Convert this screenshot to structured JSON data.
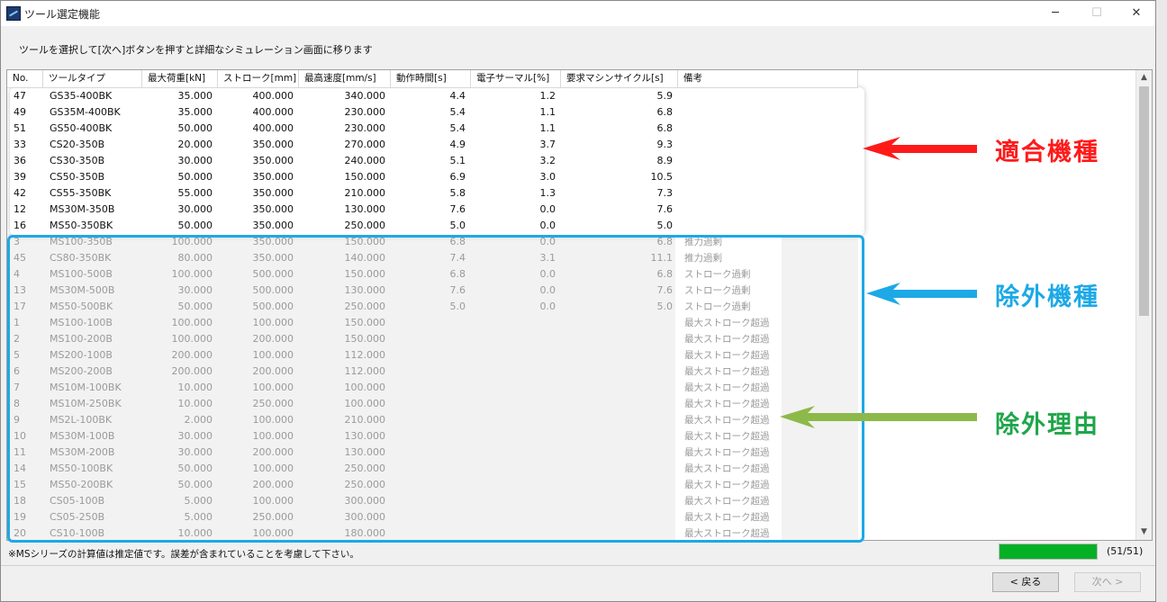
{
  "window": {
    "title": "ツール選定機能",
    "minimize": "─",
    "maximize": "☐",
    "close": "✕"
  },
  "instruction": "ツールを選択して[次へ]ボタンを押すと詳細なシミュレーション画面に移ります",
  "table": {
    "headers": [
      "No.",
      "ツールタイプ",
      "最大荷重[kN]",
      "ストローク[mm]",
      "最高速度[mm/s]",
      "動作時間[s]",
      "電子サーマル[%]",
      "要求マシンサイクル[s]",
      "備考"
    ],
    "ok_rows": [
      [
        "47",
        "GS35-400BK",
        "35.000",
        "400.000",
        "340.000",
        "4.4",
        "1.2",
        "5.9",
        ""
      ],
      [
        "49",
        "GS35M-400BK",
        "35.000",
        "400.000",
        "230.000",
        "5.4",
        "1.1",
        "6.8",
        ""
      ],
      [
        "51",
        "GS50-400BK",
        "50.000",
        "400.000",
        "230.000",
        "5.4",
        "1.1",
        "6.8",
        ""
      ],
      [
        "33",
        "CS20-350B",
        "20.000",
        "350.000",
        "270.000",
        "4.9",
        "3.7",
        "9.3",
        ""
      ],
      [
        "36",
        "CS30-350B",
        "30.000",
        "350.000",
        "240.000",
        "5.1",
        "3.2",
        "8.9",
        ""
      ],
      [
        "39",
        "CS50-350B",
        "50.000",
        "350.000",
        "150.000",
        "6.9",
        "3.0",
        "10.5",
        ""
      ],
      [
        "42",
        "CS55-350BK",
        "55.000",
        "350.000",
        "210.000",
        "5.8",
        "1.3",
        "7.3",
        ""
      ],
      [
        "12",
        "MS30M-350B",
        "30.000",
        "350.000",
        "130.000",
        "7.6",
        "0.0",
        "7.6",
        ""
      ],
      [
        "16",
        "MS50-350BK",
        "50.000",
        "350.000",
        "250.000",
        "5.0",
        "0.0",
        "5.0",
        ""
      ]
    ],
    "ex_rows": [
      [
        "3",
        "MS100-350B",
        "100.000",
        "350.000",
        "150.000",
        "6.8",
        "0.0",
        "6.8",
        "推力過剰"
      ],
      [
        "45",
        "CS80-350BK",
        "80.000",
        "350.000",
        "140.000",
        "7.4",
        "3.1",
        "11.1",
        "推力過剰"
      ],
      [
        "4",
        "MS100-500B",
        "100.000",
        "500.000",
        "150.000",
        "6.8",
        "0.0",
        "6.8",
        "ストローク過剰"
      ],
      [
        "13",
        "MS30M-500B",
        "30.000",
        "500.000",
        "130.000",
        "7.6",
        "0.0",
        "7.6",
        "ストローク過剰"
      ],
      [
        "17",
        "MS50-500BK",
        "50.000",
        "500.000",
        "250.000",
        "5.0",
        "0.0",
        "5.0",
        "ストローク過剰"
      ],
      [
        "1",
        "MS100-100B",
        "100.000",
        "100.000",
        "150.000",
        "",
        "",
        "",
        "最大ストローク超過"
      ],
      [
        "2",
        "MS100-200B",
        "100.000",
        "200.000",
        "150.000",
        "",
        "",
        "",
        "最大ストローク超過"
      ],
      [
        "5",
        "MS200-100B",
        "200.000",
        "100.000",
        "112.000",
        "",
        "",
        "",
        "最大ストローク超過"
      ],
      [
        "6",
        "MS200-200B",
        "200.000",
        "200.000",
        "112.000",
        "",
        "",
        "",
        "最大ストローク超過"
      ],
      [
        "7",
        "MS10M-100BK",
        "10.000",
        "100.000",
        "100.000",
        "",
        "",
        "",
        "最大ストローク超過"
      ],
      [
        "8",
        "MS10M-250BK",
        "10.000",
        "250.000",
        "100.000",
        "",
        "",
        "",
        "最大ストローク超過"
      ],
      [
        "9",
        "MS2L-100BK",
        "2.000",
        "100.000",
        "210.000",
        "",
        "",
        "",
        "最大ストローク超過"
      ],
      [
        "10",
        "MS30M-100B",
        "30.000",
        "100.000",
        "130.000",
        "",
        "",
        "",
        "最大ストローク超過"
      ],
      [
        "11",
        "MS30M-200B",
        "30.000",
        "200.000",
        "130.000",
        "",
        "",
        "",
        "最大ストローク超過"
      ],
      [
        "14",
        "MS50-100BK",
        "50.000",
        "100.000",
        "250.000",
        "",
        "",
        "",
        "最大ストローク超過"
      ],
      [
        "15",
        "MS50-200BK",
        "50.000",
        "200.000",
        "250.000",
        "",
        "",
        "",
        "最大ストローク超過"
      ],
      [
        "18",
        "CS05-100B",
        "5.000",
        "100.000",
        "300.000",
        "",
        "",
        "",
        "最大ストローク超過"
      ],
      [
        "19",
        "CS05-250B",
        "5.000",
        "250.000",
        "300.000",
        "",
        "",
        "",
        "最大ストローク超過"
      ],
      [
        "20",
        "CS10-100B",
        "10.000",
        "100.000",
        "180.000",
        "",
        "",
        "",
        "最大ストローク超過"
      ]
    ]
  },
  "annotations": {
    "ok_label": "適合機種",
    "excluded_label": "除外機種",
    "reason_label": "除外理由"
  },
  "colors": {
    "ok_arrow": "#ff1a1a",
    "excluded_arrow": "#1ca9e6",
    "reason_arrow": "#8db94a",
    "progress": "#06b025"
  },
  "footer": {
    "note": "※MSシリーズの計算値は推定値です。誤差が含まれていることを考慮して下さい。",
    "progress_fraction": 1.0,
    "progress_count": "(51/51)",
    "back_button": "< 戻る",
    "next_button": "次へ >"
  }
}
